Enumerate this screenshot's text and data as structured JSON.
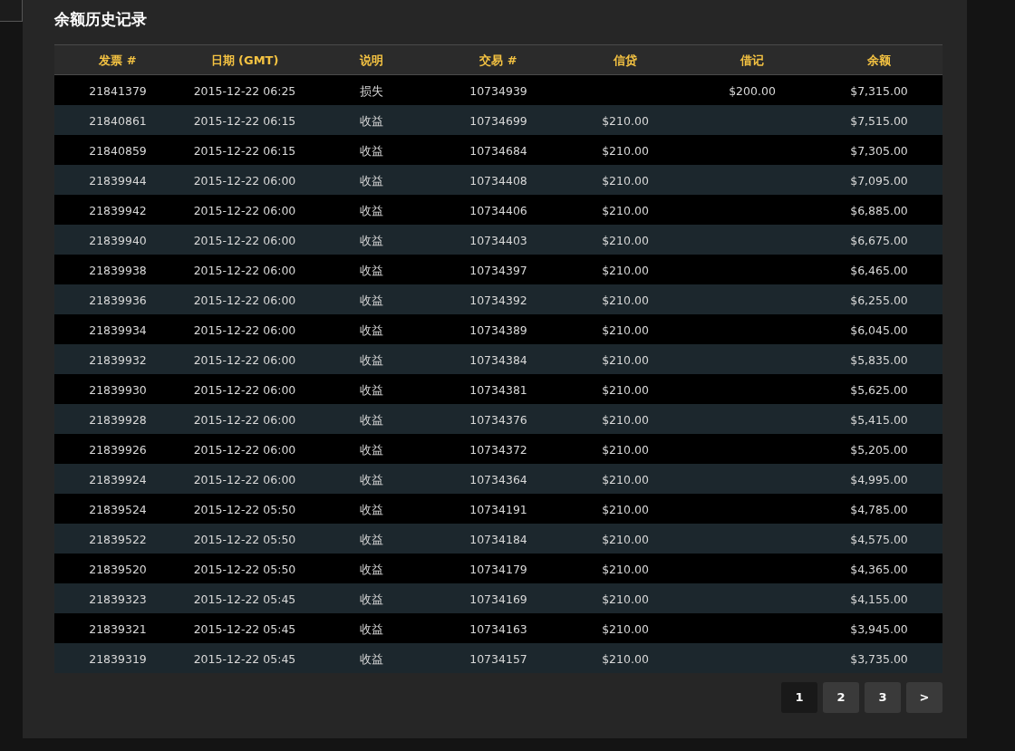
{
  "title": "余额历史记录",
  "table": {
    "columns": [
      "发票 #",
      "日期 (GMT)",
      "说明",
      "交易 #",
      "信贷",
      "借记",
      "余额"
    ],
    "rows": [
      [
        "21841379",
        "2015-12-22 06:25",
        "损失",
        "10734939",
        "",
        "$200.00",
        "$7,315.00"
      ],
      [
        "21840861",
        "2015-12-22 06:15",
        "收益",
        "10734699",
        "$210.00",
        "",
        "$7,515.00"
      ],
      [
        "21840859",
        "2015-12-22 06:15",
        "收益",
        "10734684",
        "$210.00",
        "",
        "$7,305.00"
      ],
      [
        "21839944",
        "2015-12-22 06:00",
        "收益",
        "10734408",
        "$210.00",
        "",
        "$7,095.00"
      ],
      [
        "21839942",
        "2015-12-22 06:00",
        "收益",
        "10734406",
        "$210.00",
        "",
        "$6,885.00"
      ],
      [
        "21839940",
        "2015-12-22 06:00",
        "收益",
        "10734403",
        "$210.00",
        "",
        "$6,675.00"
      ],
      [
        "21839938",
        "2015-12-22 06:00",
        "收益",
        "10734397",
        "$210.00",
        "",
        "$6,465.00"
      ],
      [
        "21839936",
        "2015-12-22 06:00",
        "收益",
        "10734392",
        "$210.00",
        "",
        "$6,255.00"
      ],
      [
        "21839934",
        "2015-12-22 06:00",
        "收益",
        "10734389",
        "$210.00",
        "",
        "$6,045.00"
      ],
      [
        "21839932",
        "2015-12-22 06:00",
        "收益",
        "10734384",
        "$210.00",
        "",
        "$5,835.00"
      ],
      [
        "21839930",
        "2015-12-22 06:00",
        "收益",
        "10734381",
        "$210.00",
        "",
        "$5,625.00"
      ],
      [
        "21839928",
        "2015-12-22 06:00",
        "收益",
        "10734376",
        "$210.00",
        "",
        "$5,415.00"
      ],
      [
        "21839926",
        "2015-12-22 06:00",
        "收益",
        "10734372",
        "$210.00",
        "",
        "$5,205.00"
      ],
      [
        "21839924",
        "2015-12-22 06:00",
        "收益",
        "10734364",
        "$210.00",
        "",
        "$4,995.00"
      ],
      [
        "21839524",
        "2015-12-22 05:50",
        "收益",
        "10734191",
        "$210.00",
        "",
        "$4,785.00"
      ],
      [
        "21839522",
        "2015-12-22 05:50",
        "收益",
        "10734184",
        "$210.00",
        "",
        "$4,575.00"
      ],
      [
        "21839520",
        "2015-12-22 05:50",
        "收益",
        "10734179",
        "$210.00",
        "",
        "$4,365.00"
      ],
      [
        "21839323",
        "2015-12-22 05:45",
        "收益",
        "10734169",
        "$210.00",
        "",
        "$4,155.00"
      ],
      [
        "21839321",
        "2015-12-22 05:45",
        "收益",
        "10734163",
        "$210.00",
        "",
        "$3,945.00"
      ],
      [
        "21839319",
        "2015-12-22 05:45",
        "收益",
        "10734157",
        "$210.00",
        "",
        "$3,735.00"
      ]
    ]
  },
  "pagination": [
    {
      "label": "1",
      "selected": true
    },
    {
      "label": "2",
      "selected": false
    },
    {
      "label": "3",
      "selected": false
    },
    {
      "label": ">",
      "selected": false
    }
  ]
}
